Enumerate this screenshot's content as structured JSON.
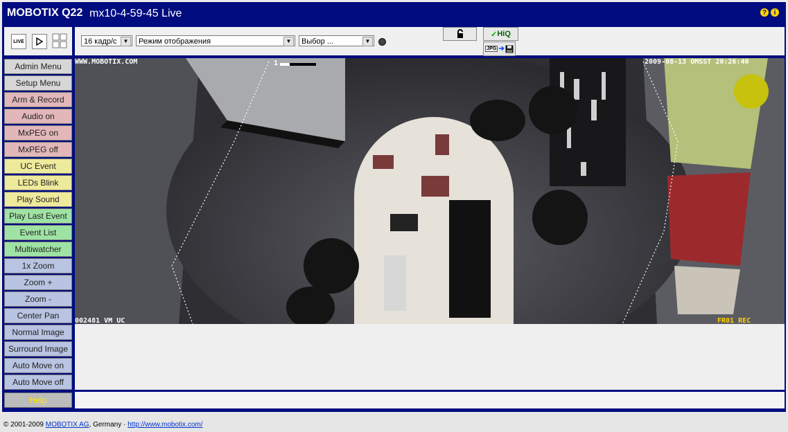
{
  "title": {
    "model": "MOBOTIX Q22",
    "subtitle": "mx10-4-59-45 Live"
  },
  "help_icons": [
    "?",
    "i"
  ],
  "toolbar": {
    "live_label": "LIVE",
    "fps_select": "16 кадр/с",
    "display_mode_select": "Режим отображения",
    "choice_select": "Выбор ...",
    "hiq_label": "HiQ",
    "jpg_label": "JPG"
  },
  "sidebar": [
    {
      "label": "Admin Menu",
      "color": "gray"
    },
    {
      "label": "Setup Menu",
      "color": "gray"
    },
    {
      "label": "Arm & Record",
      "color": "pink"
    },
    {
      "label": "Audio on",
      "color": "pink"
    },
    {
      "label": "MxPEG on",
      "color": "pink"
    },
    {
      "label": "MxPEG off",
      "color": "pink"
    },
    {
      "label": "UC Event",
      "color": "yellow"
    },
    {
      "label": "LEDs Blink",
      "color": "yellow"
    },
    {
      "label": "Play Sound",
      "color": "yellow"
    },
    {
      "label": "Play Last Event",
      "color": "green"
    },
    {
      "label": "Event List",
      "color": "green"
    },
    {
      "label": "Multiwatcher",
      "color": "green"
    },
    {
      "label": "1x Zoom",
      "color": "blue"
    },
    {
      "label": "Zoom +",
      "color": "blue"
    },
    {
      "label": "Zoom -",
      "color": "blue"
    },
    {
      "label": "Center Pan",
      "color": "blue"
    },
    {
      "label": "Normal Image",
      "color": "blue"
    },
    {
      "label": "Surround Image",
      "color": "blue"
    },
    {
      "label": "Auto Move on",
      "color": "blue"
    },
    {
      "label": "Auto Move off",
      "color": "blue"
    }
  ],
  "help_button": "Help",
  "video_osd": {
    "top_left": "WWW.MOBOTIX.COM",
    "top_right": "2009-08-13 OMSST 20:26:40",
    "bottom_left": "002481 VM UC",
    "bottom_right": "FR01 REC",
    "marker": "1"
  },
  "footer": {
    "copyright": "© 2001-2009",
    "company_link": "MOBOTIX AG",
    "country": ", Germany ·",
    "url_link": "http://www.mobotix.com/"
  }
}
